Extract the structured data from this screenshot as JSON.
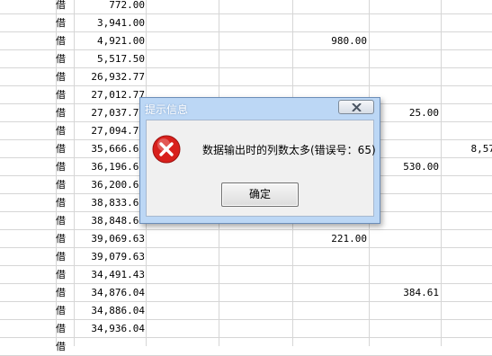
{
  "dialog": {
    "title": "提示信息",
    "message": "数据输出时的列数太多(错误号：65)",
    "ok_label": "确定",
    "icon": "error-icon"
  },
  "sheet": {
    "rows": [
      {
        "dir": "借",
        "balance": "772.00",
        "c3": "",
        "c4": "",
        "c5": ""
      },
      {
        "dir": "借",
        "balance": "3,941.00",
        "c3": "",
        "c4": "",
        "c5": ""
      },
      {
        "dir": "借",
        "balance": "4,921.00",
        "c3": "980.00",
        "c4": "",
        "c5": ""
      },
      {
        "dir": "借",
        "balance": "5,517.50",
        "c3": "",
        "c4": "",
        "c5": ""
      },
      {
        "dir": "借",
        "balance": "26,932.77",
        "c3": "",
        "c4": "",
        "c5": ""
      },
      {
        "dir": "借",
        "balance": "27,012.77",
        "c3": "",
        "c4": "",
        "c5": ""
      },
      {
        "dir": "借",
        "balance": "27,037.77",
        "c3": "",
        "c4": "25.00",
        "c5": ""
      },
      {
        "dir": "借",
        "balance": "27,094.77",
        "c3": "",
        "c4": "",
        "c5": ""
      },
      {
        "dir": "借",
        "balance": "35,666.67",
        "c3": "",
        "c4": "",
        "c5": "8,57"
      },
      {
        "dir": "借",
        "balance": "36,196.67",
        "c3": "",
        "c4": "530.00",
        "c5": ""
      },
      {
        "dir": "借",
        "balance": "36,200.67",
        "c3": "",
        "c4": "",
        "c5": ""
      },
      {
        "dir": "借",
        "balance": "38,833.67",
        "c3": "",
        "c4": "",
        "c5": ""
      },
      {
        "dir": "借",
        "balance": "38,848.63",
        "c3": "",
        "c4": "",
        "c5": ""
      },
      {
        "dir": "借",
        "balance": "39,069.63",
        "c3": "221.00",
        "c4": "",
        "c5": ""
      },
      {
        "dir": "借",
        "balance": "39,079.63",
        "c3": "",
        "c4": "",
        "c5": ""
      },
      {
        "dir": "借",
        "balance": "34,491.43",
        "c3": "",
        "c4": "",
        "c5": ""
      },
      {
        "dir": "借",
        "balance": "34,876.04",
        "c3": "",
        "c4": "384.61",
        "c5": ""
      },
      {
        "dir": "借",
        "balance": "34,886.04",
        "c3": "",
        "c4": "",
        "c5": ""
      },
      {
        "dir": "借",
        "balance": "34,936.04",
        "c3": "",
        "c4": "",
        "c5": ""
      },
      {
        "dir": "借",
        "balance": "",
        "c3": "",
        "c4": "",
        "c5": ""
      }
    ]
  },
  "colors": {
    "dialog_frame": "#bcd7f5",
    "error_red": "#d8201c",
    "grid_line": "#d6d6d6"
  }
}
